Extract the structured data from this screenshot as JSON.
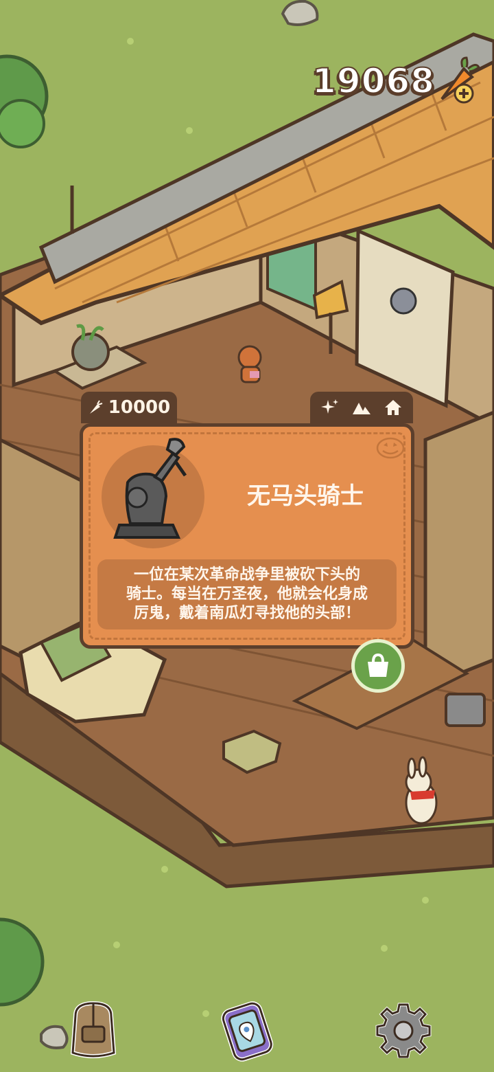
{
  "currency": {
    "amount": "19068",
    "icon": "carrot-add-icon"
  },
  "item_panel": {
    "price": "10000",
    "price_icon": "carrot-icon",
    "tags": [
      "sparkle-icon",
      "mountain-icon",
      "house-icon"
    ],
    "title": "无马头骑士",
    "description_lines": [
      "一位在某次革命战争里被砍下头的",
      "骑士。每当在万圣夜，他就会化身成",
      "厉鬼，戴着南瓜灯寻找他的头部！"
    ],
    "image": "headless-knight-statue",
    "theme_icon": "jack-o-lantern-icon"
  },
  "shop_button": {
    "icon": "shopping-bag-icon"
  },
  "toolbar": {
    "items": [
      {
        "name": "backpack-button",
        "icon": "backpack-icon"
      },
      {
        "name": "phone-button",
        "icon": "phone-map-icon"
      },
      {
        "name": "settings-button",
        "icon": "gear-icon"
      }
    ]
  },
  "colors": {
    "grass": "#9cb45f",
    "panel_orange": "#e58f4f",
    "panel_dark": "#c57a44",
    "border_brown": "#5c3f2c",
    "floor_wood": "#9a6a45",
    "wall_tan": "#cdb48c",
    "roof_orange": "#e0a252"
  }
}
